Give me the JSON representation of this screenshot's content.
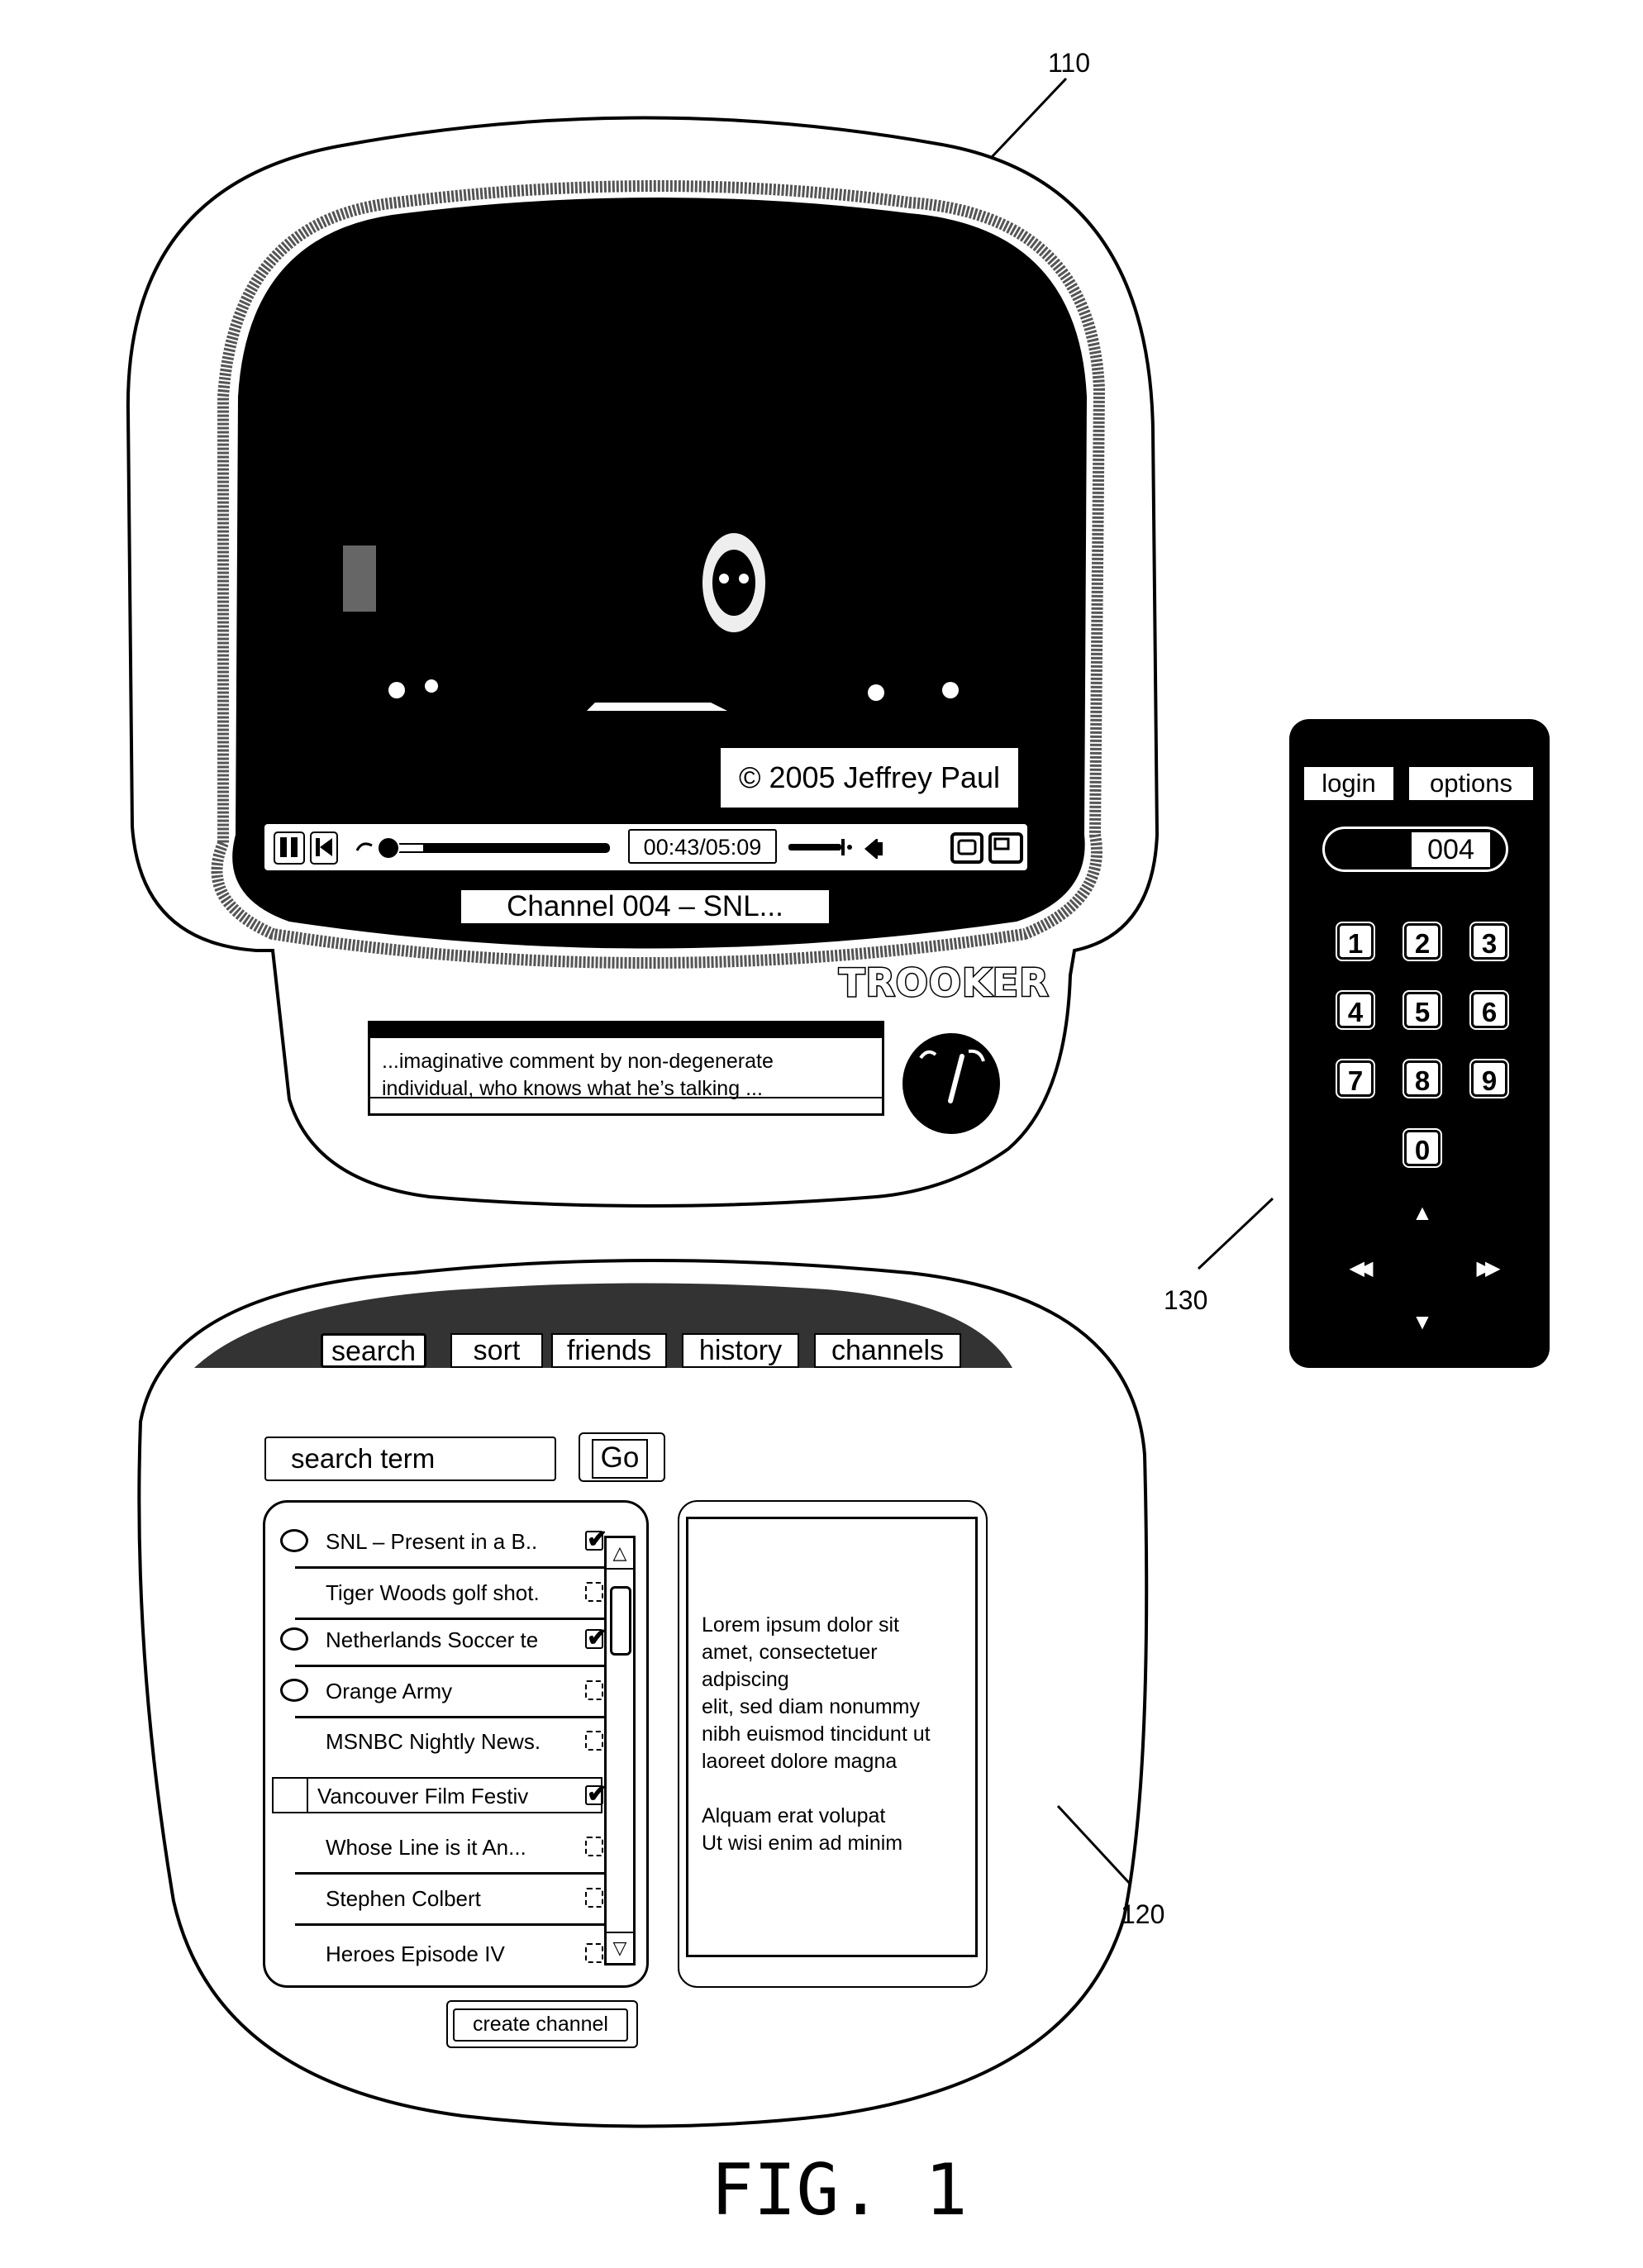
{
  "figure": {
    "caption": "FIG. 1",
    "reference_labels": {
      "tv": "110",
      "browser_panel": "120",
      "remote": "130"
    }
  },
  "player": {
    "copyright": "© 2005 Jeffrey Paul",
    "time": "00:43/05:09",
    "progress_fraction": 0.14,
    "volume_fraction": 0.85,
    "channel_label": "Channel 004 – SNL...",
    "icons": [
      "pause-icon",
      "skip-back-icon",
      "seek-slider",
      "volume-slider",
      "speaker-icon",
      "fullscreen-icon",
      "popout-icon"
    ],
    "brand": "TROOKER",
    "comment": "...imaginative comment by non-degenerate individual, who knows what he’s talking ...",
    "comment_line1": "...imaginative comment by non-degenerate",
    "comment_line2": "individual, who knows what he’s talking ..."
  },
  "browser": {
    "tabs": [
      {
        "label": "search",
        "active": true
      },
      {
        "label": "sort",
        "active": false
      },
      {
        "label": "friends",
        "active": false
      },
      {
        "label": "history",
        "active": false
      },
      {
        "label": "channels",
        "active": false
      }
    ],
    "search": {
      "value": "search term",
      "go_label": "Go"
    },
    "results": [
      {
        "title": "SNL – Present in a B..",
        "shared": true,
        "checked": true,
        "selected": false
      },
      {
        "title": "Tiger Woods golf shot.",
        "shared": false,
        "checked": false,
        "selected": false
      },
      {
        "title": "Netherlands Soccer te",
        "shared": true,
        "checked": true,
        "selected": false
      },
      {
        "title": "Orange Army",
        "shared": true,
        "checked": false,
        "selected": false
      },
      {
        "title": "MSNBC Nightly News.",
        "shared": false,
        "checked": false,
        "selected": false
      },
      {
        "title": "Vancouver Film Festiv",
        "shared": false,
        "checked": true,
        "selected": true
      },
      {
        "title": "Whose Line is it An...",
        "shared": false,
        "checked": false,
        "selected": false
      },
      {
        "title": "Stephen Colbert",
        "shared": false,
        "checked": false,
        "selected": false
      },
      {
        "title": "Heroes Episode IV",
        "shared": false,
        "checked": false,
        "selected": false
      }
    ],
    "scroll_up": "△",
    "scroll_down": "▽",
    "description": "Lorem ipsum dolor sit\namet, consectetuer\nadpiscing\nelit, sed diam nonummy\nnibh euismod tincidunt ut\nlaoreet dolore magna\n\nAlquam erat volupat\nUt wisi enim ad minim",
    "create_channel_label": "create channel",
    "check_glyph": "✔"
  },
  "remote": {
    "login_label": "login",
    "options_label": "options",
    "channel_value": "004",
    "keys": [
      "1",
      "2",
      "3",
      "4",
      "5",
      "6",
      "7",
      "8",
      "9",
      "0"
    ],
    "dpad": {
      "up": "▲",
      "down": "▼",
      "left": "◀◀",
      "right": "▶▶"
    }
  }
}
